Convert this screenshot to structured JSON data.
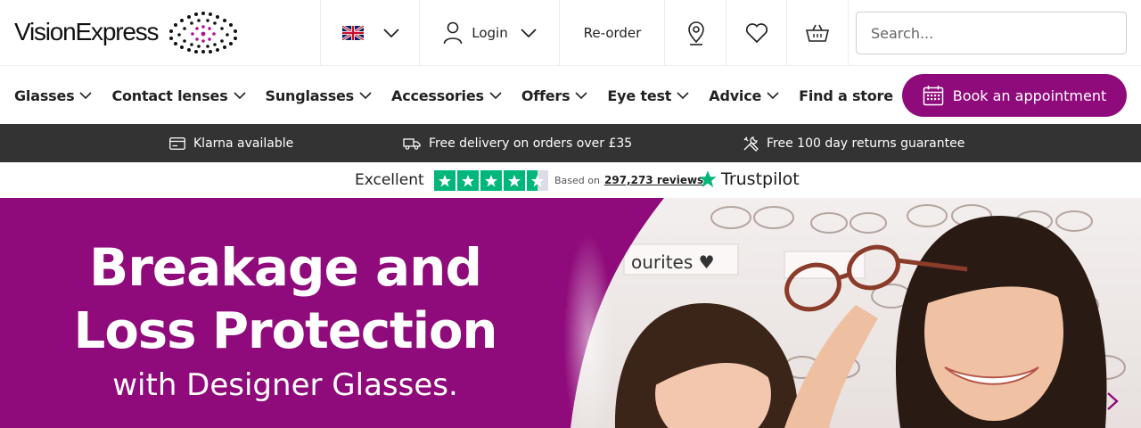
{
  "header": {
    "logo_text": "VisionExpress",
    "login_label": "Login",
    "reorder_label": "Re-order",
    "search_placeholder": "Search..."
  },
  "nav": {
    "items": [
      {
        "label": "Glasses",
        "has_dropdown": true
      },
      {
        "label": "Contact lenses",
        "has_dropdown": true
      },
      {
        "label": "Sunglasses",
        "has_dropdown": true
      },
      {
        "label": "Accessories",
        "has_dropdown": true
      },
      {
        "label": "Offers",
        "has_dropdown": true
      },
      {
        "label": "Eye test",
        "has_dropdown": true
      },
      {
        "label": "Advice",
        "has_dropdown": true
      },
      {
        "label": "Find a store",
        "has_dropdown": false
      }
    ],
    "book_label": "Book an appointment"
  },
  "usp": {
    "klarna": "Klarna available",
    "delivery": "Free delivery on orders over £35",
    "returns": "Free 100 day returns guarantee"
  },
  "trustpilot": {
    "rating_text": "Excellent",
    "stars": 4.5,
    "based_on": "Based on",
    "reviews": "297,273 reviews",
    "brand": "Trustpilot"
  },
  "hero": {
    "line1": "Breakage and",
    "line2": "Loss Protection",
    "subline": "with Designer Glasses.",
    "shelf_text": "ourites ♥"
  },
  "colors": {
    "brand_purple": "#8f0a7a",
    "usp_bar": "#333333",
    "trustpilot_green": "#00b67a"
  }
}
